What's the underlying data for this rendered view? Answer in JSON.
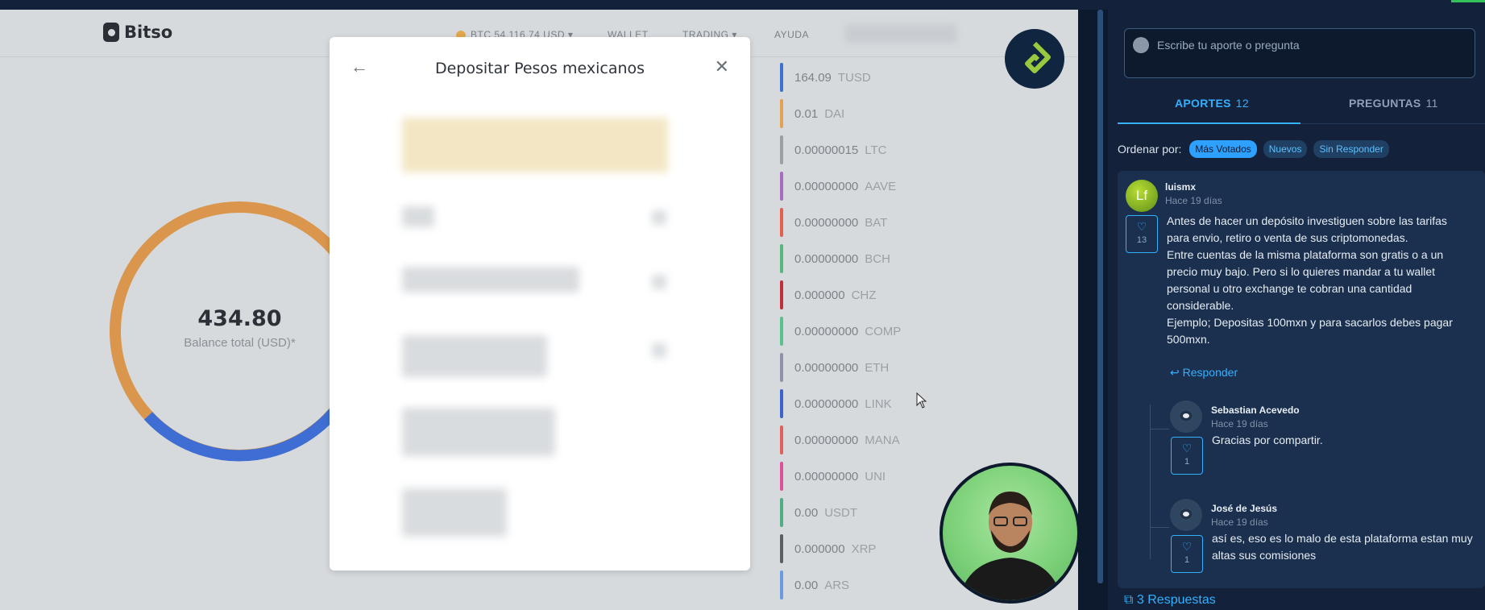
{
  "bitso": {
    "logo": "Bitso",
    "nav": {
      "btc": "BTC 54,116.74 USD",
      "wallet": "WALLET",
      "trading": "TRADING",
      "ayuda": "AYUDA"
    },
    "balance_value": "434.80",
    "balance_label": "Balance total (USD)*",
    "coins": [
      {
        "amount": "164.09",
        "symbol": "TUSD",
        "color": "#3f6fcf"
      },
      {
        "amount": "0.01",
        "symbol": "DAI",
        "color": "#e2a24f"
      },
      {
        "amount": "0.00000015",
        "symbol": "LTC",
        "color": "#9aa0a6"
      },
      {
        "amount": "0.00000000",
        "symbol": "AAVE",
        "color": "#a86bc0"
      },
      {
        "amount": "0.00000000",
        "symbol": "BAT",
        "color": "#e2604d"
      },
      {
        "amount": "0.00000000",
        "symbol": "BCH",
        "color": "#58b77a"
      },
      {
        "amount": "0.000000",
        "symbol": "CHZ",
        "color": "#c0303a"
      },
      {
        "amount": "0.00000000",
        "symbol": "COMP",
        "color": "#5ac08e"
      },
      {
        "amount": "0.00000000",
        "symbol": "ETH",
        "color": "#8d93a8"
      },
      {
        "amount": "0.00000000",
        "symbol": "LINK",
        "color": "#3a64c9"
      },
      {
        "amount": "0.00000000",
        "symbol": "MANA",
        "color": "#e0605b"
      },
      {
        "amount": "0.00000000",
        "symbol": "UNI",
        "color": "#e0509a"
      },
      {
        "amount": "0.00",
        "symbol": "USDT",
        "color": "#4fae86"
      },
      {
        "amount": "0.000000",
        "symbol": "XRP",
        "color": "#5a5f66"
      },
      {
        "amount": "0.00",
        "symbol": "ARS",
        "color": "#6a9be0"
      }
    ],
    "modal_title": "Depositar Pesos mexicanos",
    "donut_colors": {
      "primary": "#d9964c",
      "secondary": "#3e6ed3"
    }
  },
  "panel": {
    "composer_placeholder": "Escribe tu aporte o pregunta",
    "tabs": [
      {
        "label": "APORTES",
        "count": "12"
      },
      {
        "label": "PREGUNTAS",
        "count": "11"
      }
    ],
    "order_label": "Ordenar por:",
    "order_options": [
      "Más Votados",
      "Nuevos",
      "Sin Responder"
    ],
    "comment": {
      "author": "luismx",
      "time": "Hace 19 días",
      "avatar_initials": "Lf",
      "likes": "13",
      "text_lines": [
        "Antes de hacer un depósito investiguen sobre las tarifas",
        "para envio, retiro o venta de sus criptomonedas.",
        "Entre cuentas de la misma plataforma son gratis o a un",
        "precio muy bajo. Pero si lo quieres mandar a tu wallet",
        "personal u otro exchange te cobran una cantidad",
        "considerable.",
        "Ejemplo; Depositas 100mxn y para sacarlos debes pagar",
        "500mxn."
      ],
      "reply_label": "Responder"
    },
    "replies": [
      {
        "author": "Sebastian Acevedo",
        "time": "Hace 19 días",
        "likes": "1",
        "text": "Gracias por compartir."
      },
      {
        "author": "José de Jesús",
        "time": "Hace 19 días",
        "likes": "1",
        "text_lines": [
          "así es, eso es lo malo de esta plataforma estan muy",
          "altas sus comisiones"
        ]
      }
    ],
    "more_replies": "3 Respuestas",
    "accent_color": "#33b1ff"
  }
}
